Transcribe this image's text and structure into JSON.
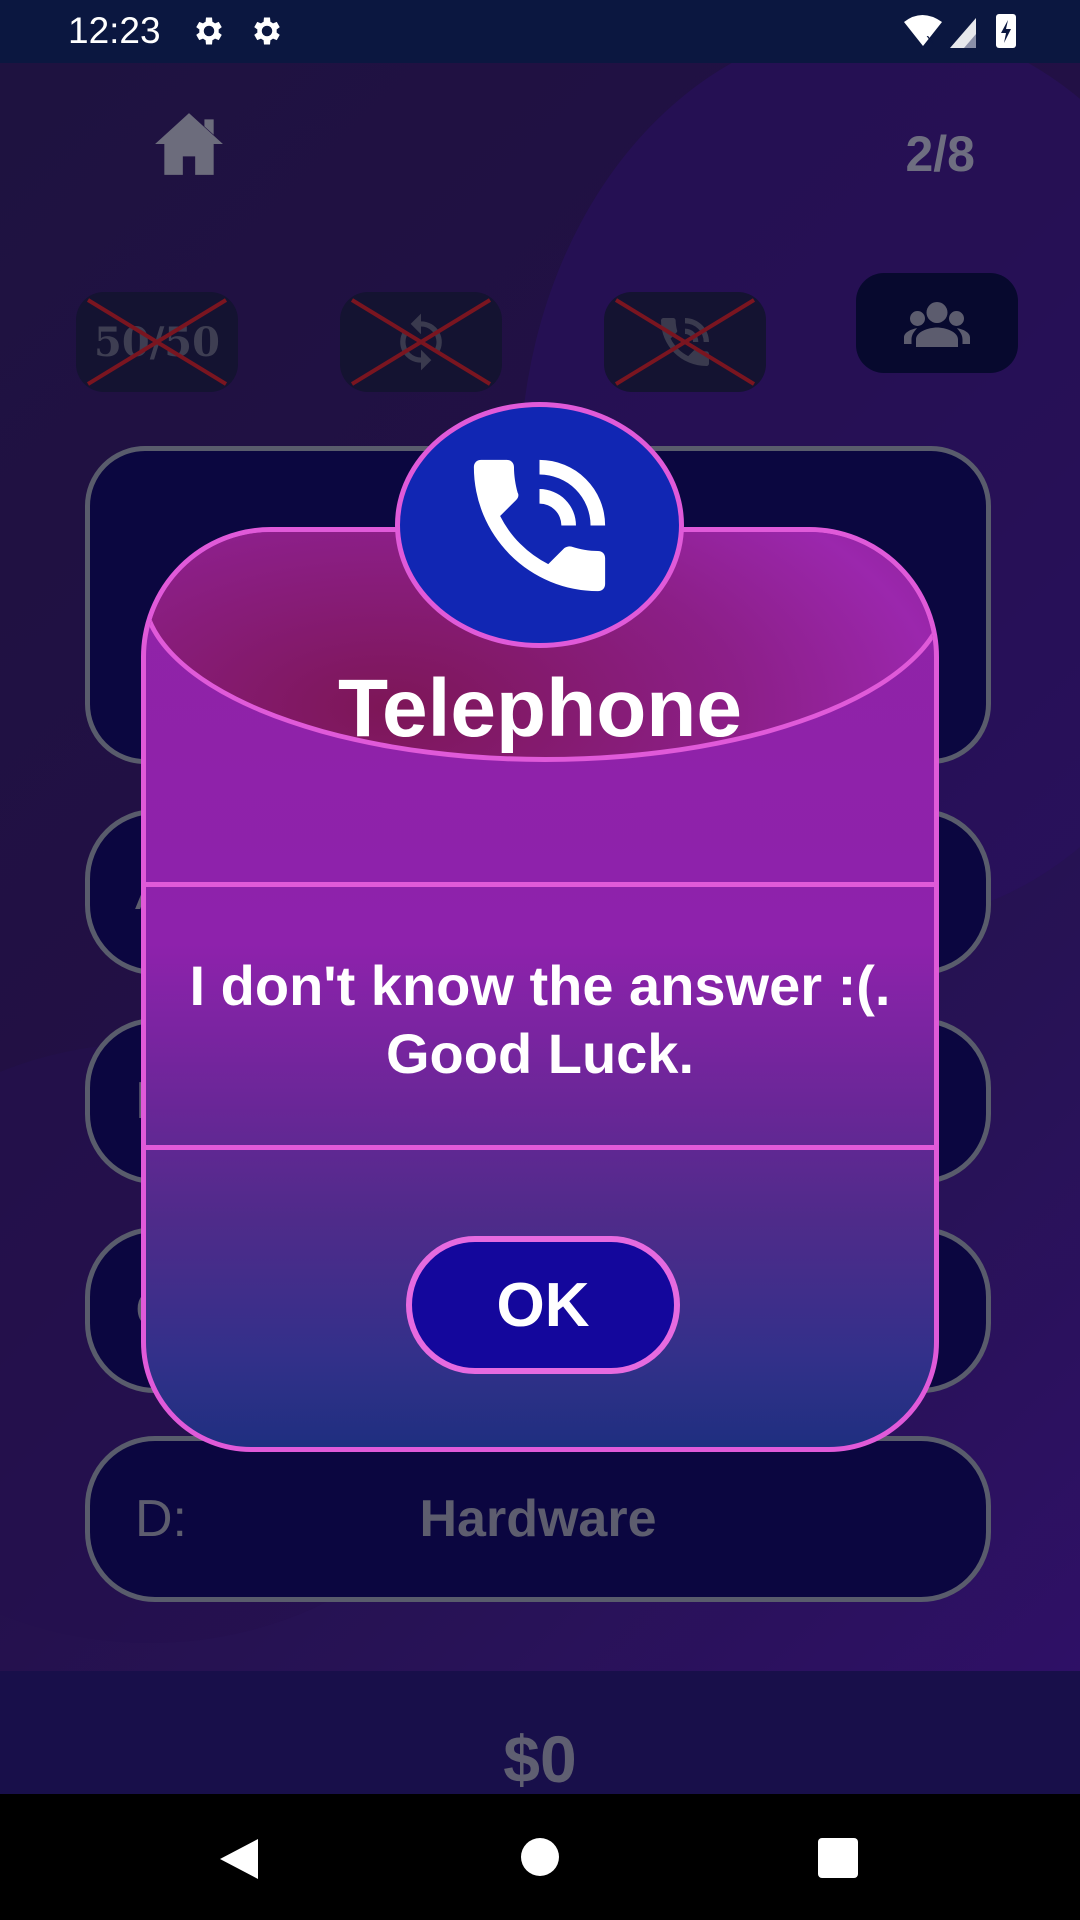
{
  "status_bar": {
    "time": "12:23",
    "icons": [
      "settings-icon",
      "settings-icon",
      "wifi-icon",
      "signal-icon",
      "battery-charging-icon"
    ]
  },
  "header": {
    "home_icon": "home-icon",
    "progress": "2/8"
  },
  "lifelines": [
    {
      "name": "fifty-fifty",
      "label": "50/50",
      "used": true
    },
    {
      "name": "switch-question",
      "icon": "refresh-icon",
      "used": true
    },
    {
      "name": "phone-a-friend",
      "icon": "phone-icon",
      "used": true
    },
    {
      "name": "ask-audience",
      "icon": "group-icon",
      "used": false
    }
  ],
  "answers": [
    {
      "letter": "A:",
      "text": ""
    },
    {
      "letter": "B:",
      "text": ""
    },
    {
      "letter": "C:",
      "text": ""
    },
    {
      "letter": "D:",
      "text": "Hardware"
    }
  ],
  "footer": {
    "money": "$0"
  },
  "dialog": {
    "icon": "phone-icon",
    "title": "Telephone",
    "message": "I don't know the answer :(. Good Luck.",
    "ok_label": "OK"
  },
  "colors": {
    "accent_pink": "#e05ad9",
    "dialog_purple": "#8e22ac",
    "ok_blue": "#14079c",
    "badge_blue": "#1126b3"
  }
}
